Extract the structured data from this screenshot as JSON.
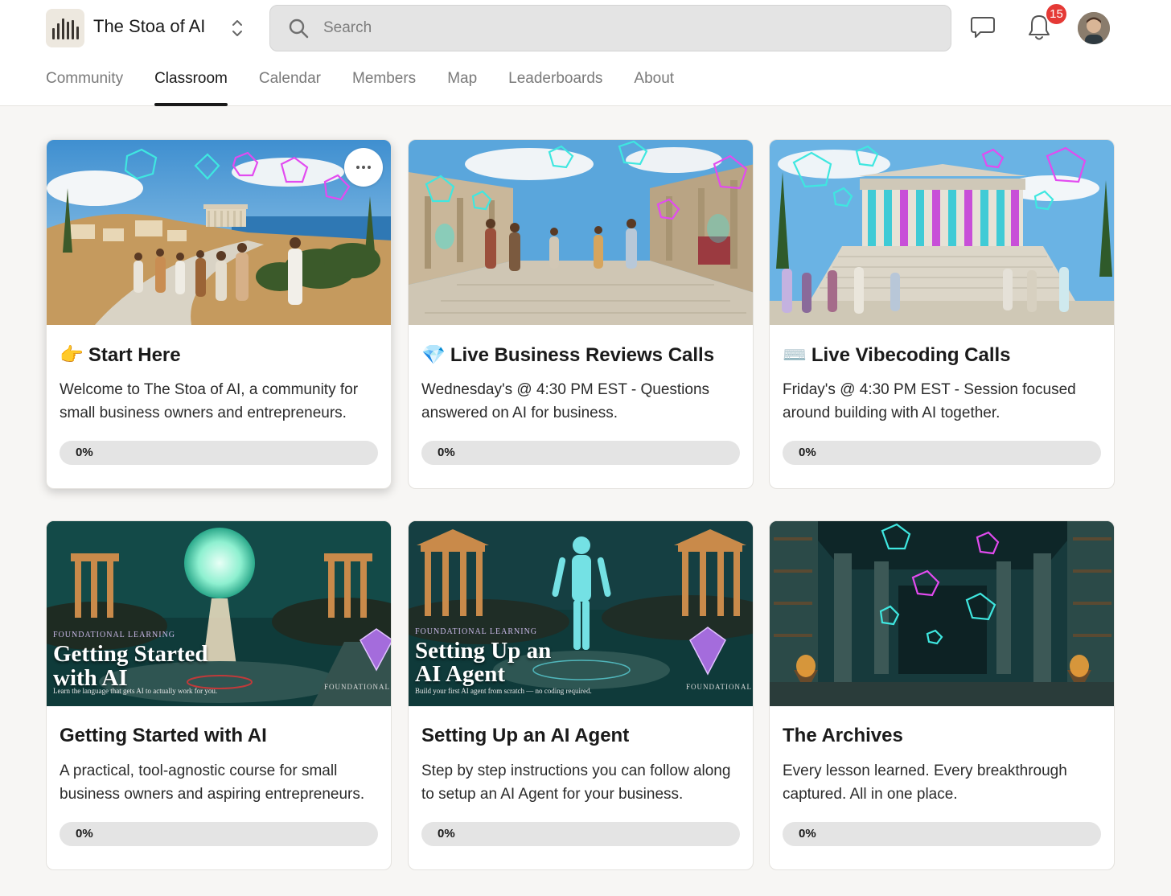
{
  "header": {
    "group_name": "The Stoa of AI",
    "search_placeholder": "Search",
    "notification_count": "15"
  },
  "tabs": [
    {
      "label": "Community",
      "active": false
    },
    {
      "label": "Classroom",
      "active": true
    },
    {
      "label": "Calendar",
      "active": false
    },
    {
      "label": "Members",
      "active": false
    },
    {
      "label": "Map",
      "active": false
    },
    {
      "label": "Leaderboards",
      "active": false
    },
    {
      "label": "About",
      "active": false
    }
  ],
  "colors": {
    "accent_dark": "#1a1a1a",
    "badge_red": "#e53935",
    "progress_track": "#e4e4e4",
    "neon_cyan": "#3fe7e0",
    "neon_magenta": "#e24bf0"
  },
  "courses": [
    {
      "emoji": "👉",
      "title": "Start Here",
      "description": "Welcome to The Stoa of AI, a community for small business owners and entrepreneurs.",
      "progress_label": "0%",
      "progress": 0,
      "image": "greek-village-road"
    },
    {
      "emoji": "💎",
      "title": "Live Business Reviews Calls",
      "description": "Wednesday's @ 4:30 PM EST - Questions answered on AI for business.",
      "progress_label": "0%",
      "progress": 0,
      "image": "agora-market"
    },
    {
      "emoji": "⌨️",
      "title": "Live Vibecoding Calls",
      "description": "Friday's @ 4:30 PM EST - Session focused around building with AI together.",
      "progress_label": "0%",
      "progress": 0,
      "image": "parthenon-gathering"
    },
    {
      "emoji": "",
      "title": "Getting Started with AI",
      "description": "A practical, tool-agnostic course for small business owners and aspiring entrepreneurs.",
      "progress_label": "0%",
      "progress": 0,
      "image": "glowing-sphere-temple",
      "overlay": {
        "kicker": "FOUNDATIONAL LEARNING",
        "title_line1": "Getting Started",
        "title_line2": "with AI",
        "subtitle": "Learn the language that gets AI to actually work for you.",
        "tag": "FOUNDATIONAL"
      }
    },
    {
      "emoji": "",
      "title": "Setting Up an AI Agent",
      "description": "Step by step instructions you can follow along to setup an AI Agent for your business.",
      "progress_label": "0%",
      "progress": 0,
      "image": "holographic-figure-temple",
      "overlay": {
        "kicker": "FOUNDATIONAL LEARNING",
        "title_line1": "Setting Up an",
        "title_line2": "AI Agent",
        "subtitle": "Build your first AI agent from scratch — no coding required.",
        "tag": "FOUNDATIONAL"
      }
    },
    {
      "emoji": "",
      "title": "The Archives",
      "description": "Every lesson learned. Every breakthrough captured. All in one place.",
      "progress_label": "0%",
      "progress": 0,
      "image": "ancient-library"
    }
  ]
}
